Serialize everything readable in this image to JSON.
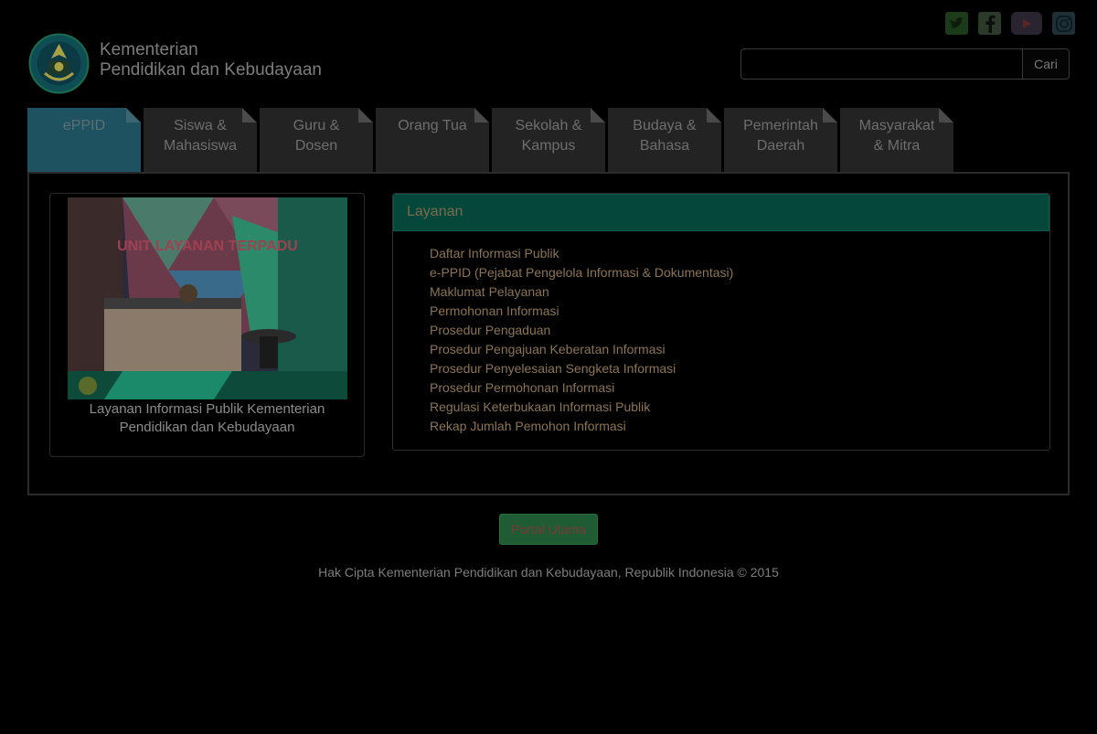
{
  "header": {
    "brand_line1": "Kementerian",
    "brand_line2": "Pendidikan dan Kebudayaan",
    "logo_icon": "tut-wuri-handayani-logo"
  },
  "social": [
    {
      "name": "twitter-icon"
    },
    {
      "name": "facebook-icon"
    },
    {
      "name": "youtube-icon"
    },
    {
      "name": "instagram-icon"
    }
  ],
  "search": {
    "value": "",
    "placeholder": "",
    "button_label": "Cari"
  },
  "tabs": [
    {
      "label": "ePPID",
      "active": true
    },
    {
      "label": "Siswa & Mahasiswa",
      "active": false
    },
    {
      "label": "Guru & Dosen",
      "active": false
    },
    {
      "label": "Orang Tua",
      "active": false
    },
    {
      "label": "Sekolah & Kampus",
      "active": false
    },
    {
      "label": "Budaya & Bahasa",
      "active": false
    },
    {
      "label": "Pemerintah Daerah",
      "active": false
    },
    {
      "label": "Masyarakat & Mitra",
      "active": false
    }
  ],
  "photo_card": {
    "caption": "Layanan Informasi Publik Kementerian Pendidikan dan Kebudayaan",
    "photo_text": "UNIT LAYANAN TERPADU"
  },
  "services": {
    "title": "Layanan",
    "items": [
      "Daftar Informasi Publik",
      "e-PPID (Pejabat Pengelola Informasi & Dokumentasi)",
      "Maklumat Pelayanan",
      "Permohonan Informasi",
      "Prosedur Pengaduan",
      "Prosedur Pengajuan Keberatan Informasi",
      "Prosedur Penyelesaian Sengketa Informasi",
      "Prosedur Permohonan Informasi",
      "Regulasi Keterbukaan Informasi Publik",
      "Rekap Jumlah Pemohon Informasi"
    ]
  },
  "portal_button": "Portal Utama",
  "footer": "Hak Cipta Kementerian Pendidikan dan Kebudayaan, Republik Indonesia © 2015",
  "colors": {
    "active_tab": "#1f5260",
    "tab": "#232323",
    "services_header": "#06473c",
    "link": "#8c7453",
    "portal_button": "#1f5b33"
  }
}
